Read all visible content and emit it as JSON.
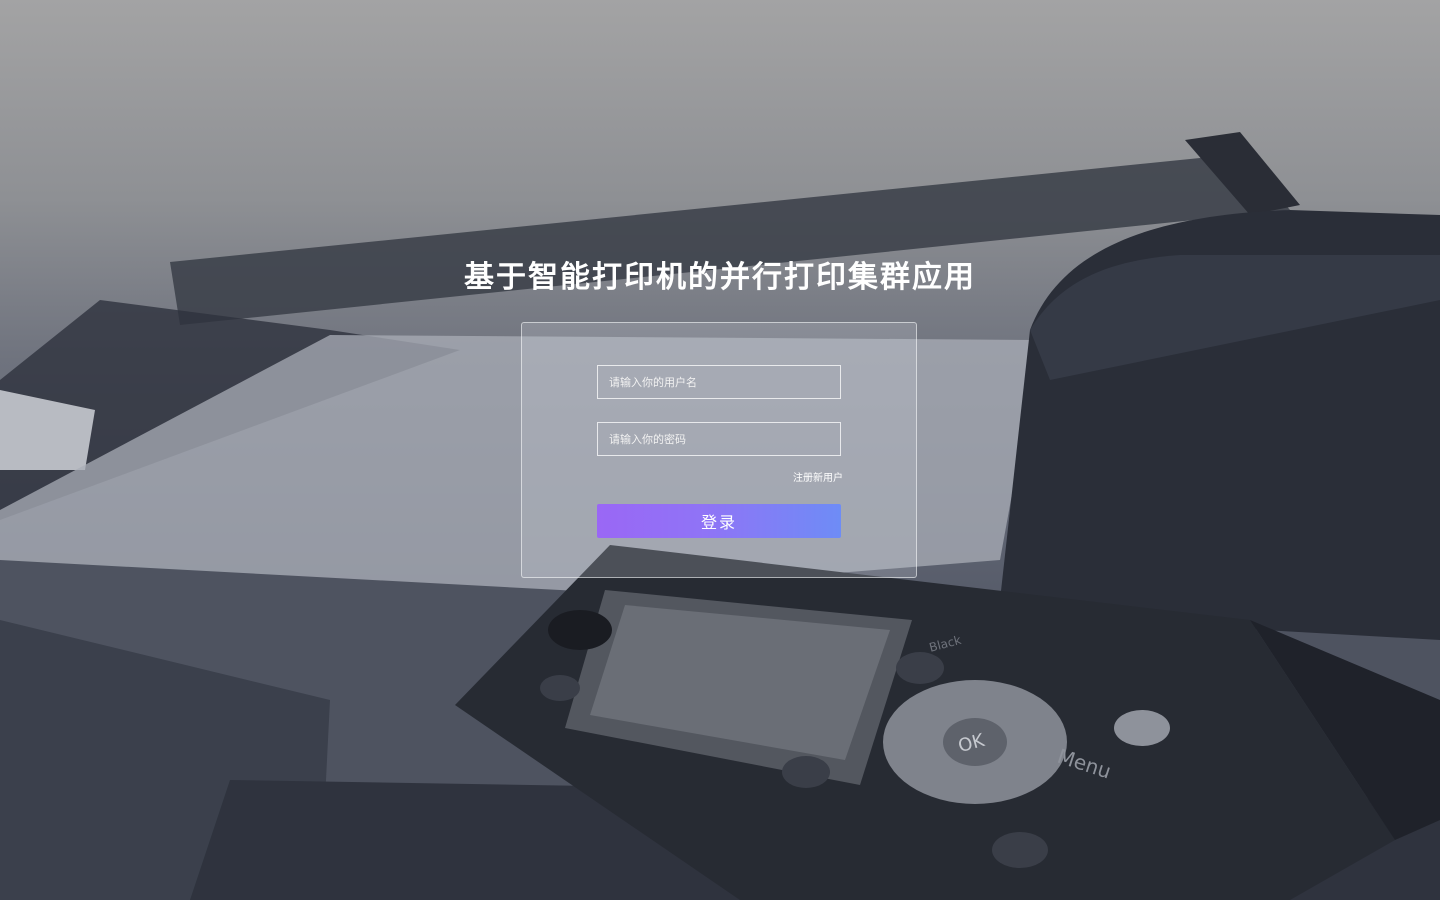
{
  "app": {
    "title": "基于智能打印机的并行打印集群应用"
  },
  "login": {
    "username_placeholder": "请输入你的用户名",
    "username_value": "",
    "password_placeholder": "请输入你的密码",
    "password_value": "",
    "register_label": "注册新用户",
    "submit_label": "登录"
  },
  "colors": {
    "button_gradient_start": "#9a67f5",
    "button_gradient_end": "#6e8cf6",
    "text": "#ffffff"
  },
  "background": {
    "subject": "printer-control-panel",
    "panel_labels": [
      "OK",
      "Menu",
      "Black"
    ]
  }
}
